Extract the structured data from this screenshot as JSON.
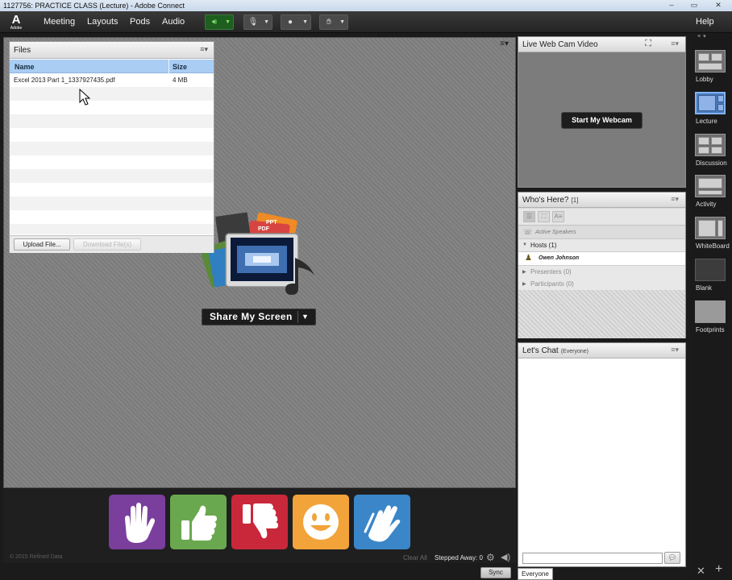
{
  "window": {
    "title": "1127756: PRACTICE CLASS (Lecture) - Adobe Connect",
    "controls": [
      "–",
      "▭",
      "✕"
    ]
  },
  "menubar": {
    "logo_letter": "A",
    "logo_text": "Adobe",
    "items": [
      "Meeting",
      "Layouts",
      "Pods",
      "Audio"
    ],
    "help": "Help",
    "speaker_status_color": "#7be36a"
  },
  "stage": {
    "menu_icon": "≡▾",
    "share_button": "Share My Screen",
    "share_dropdown": "▼",
    "share_art_labels": [
      "PPT",
      "PDF"
    ]
  },
  "files_pod": {
    "title": "Files",
    "menu_icon": "≡▾",
    "columns": [
      "Name",
      "Size"
    ],
    "files": [
      {
        "name": "Excel 2013 Part 1_1337927435.pdf",
        "size": "4 MB"
      }
    ],
    "upload_button": "Upload File...",
    "download_button": "Download File(s)"
  },
  "bottombar": {
    "emoticons": [
      {
        "name": "raise-hand",
        "color": "#7a3e9d"
      },
      {
        "name": "agree",
        "color": "#6aa84f"
      },
      {
        "name": "disagree",
        "color": "#c9283a"
      },
      {
        "name": "laugh",
        "color": "#f2a33a"
      },
      {
        "name": "applause",
        "color": "#3a86c8"
      }
    ],
    "copyright": "© 2015 Refined Data",
    "clear_all": "Clear All",
    "stepped_away": "Stepped Away: 0",
    "sync": "Sync"
  },
  "webcam_pod": {
    "title": "Live Web Cam Video",
    "start_button": "Start My Webcam"
  },
  "attendees_pod": {
    "title": "Who's Here?",
    "count": "[1]",
    "active_speakers": "Active Speakers",
    "hosts": "Hosts (1)",
    "host_name": "Owen Johnson",
    "presenters": "Presenters (0)",
    "participants": "Participants (0)"
  },
  "chat_pod": {
    "title": "Let's Chat",
    "audience": "(Everyone)",
    "tab": "Everyone"
  },
  "layouts": {
    "items": [
      "Lobby",
      "Lecture",
      "Discussion",
      "Activity",
      "WhiteBoard",
      "Blank",
      "Footprints"
    ],
    "selected": "Lecture"
  }
}
